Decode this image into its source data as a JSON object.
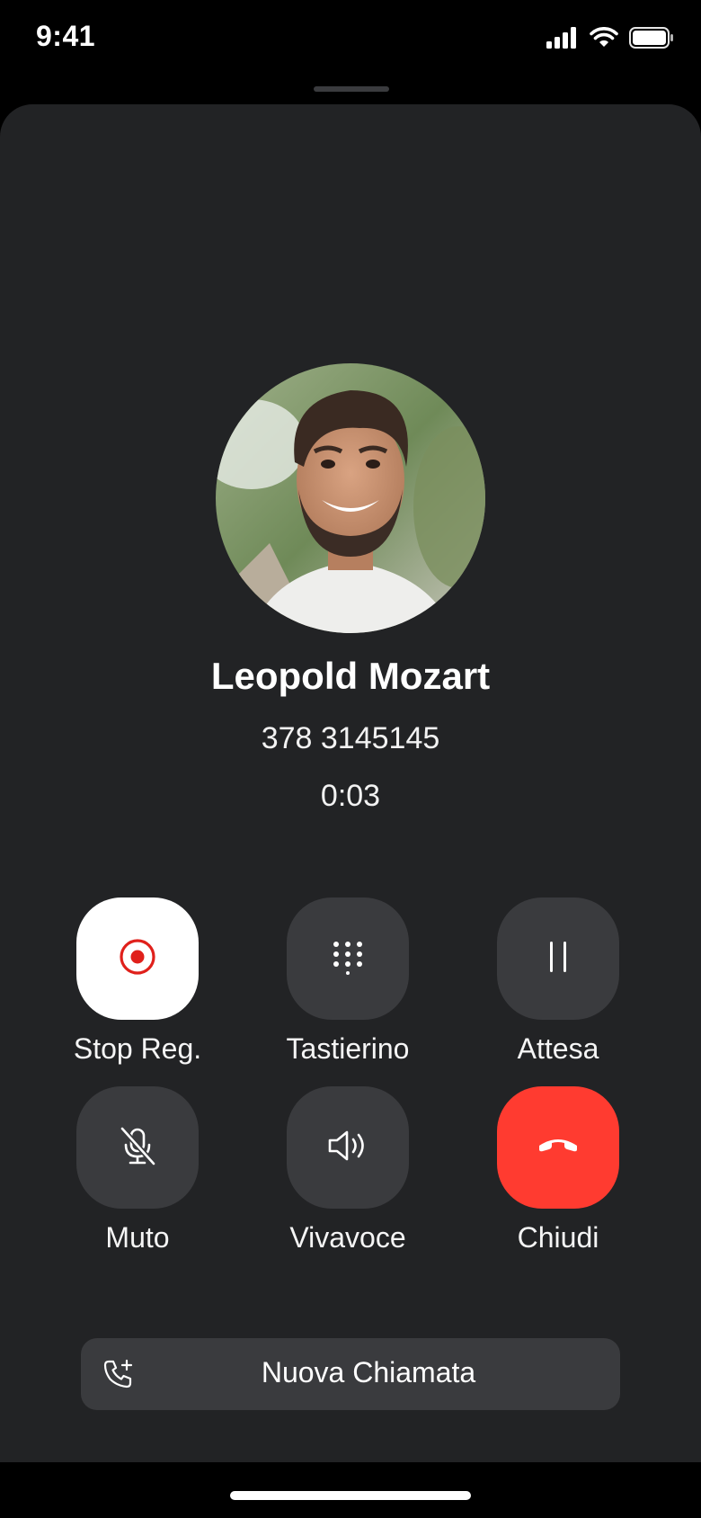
{
  "status_bar": {
    "time": "9:41",
    "icons": [
      "cellular-signal-icon",
      "wifi-icon",
      "battery-icon"
    ]
  },
  "caller": {
    "name": "Leopold Mozart",
    "number": "378 3145145",
    "duration": "0:03",
    "avatar": "avatar-photo"
  },
  "controls": [
    {
      "label": "Stop Reg.",
      "icon": "record-icon",
      "state": "active"
    },
    {
      "label": "Tastierino",
      "icon": "keypad-icon"
    },
    {
      "label": "Attesa",
      "icon": "pause-icon"
    },
    {
      "label": "Muto",
      "icon": "mic-off-icon"
    },
    {
      "label": "Vivavoce",
      "icon": "speaker-icon"
    },
    {
      "label": "Chiudi",
      "icon": "end-call-icon"
    }
  ],
  "new_call": {
    "label": "Nuova Chiamata",
    "icon": "add-call-icon"
  },
  "colors": {
    "background": "#000000",
    "sheet": "#222325",
    "button": "#3a3b3e",
    "record_active": "#ffffff",
    "record_dot": "#e0201b",
    "end_call": "#ff3b30"
  }
}
